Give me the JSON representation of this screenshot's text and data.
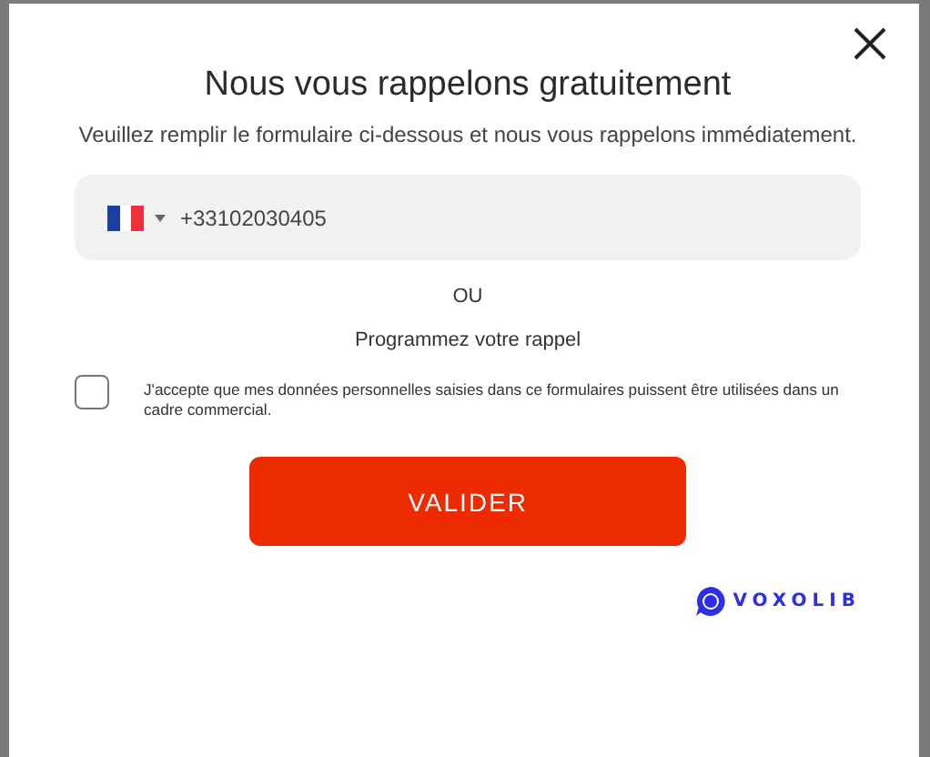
{
  "dialog": {
    "title": "Nous vous rappelons gratuitement",
    "subtitle": "Veuillez remplir le formulaire ci-dessous et nous vous rappelons immédiatement.",
    "phone": {
      "value": "+33102030405"
    },
    "separator": "OU",
    "schedule_link": "Programmez votre rappel",
    "consent": {
      "checked": false,
      "text": "J'accepte que mes données personnelles saisies dans ce formulaires puissent être utilisées dans un cadre commercial."
    },
    "submit": "VALIDER",
    "brand": "VOXOLIB"
  }
}
